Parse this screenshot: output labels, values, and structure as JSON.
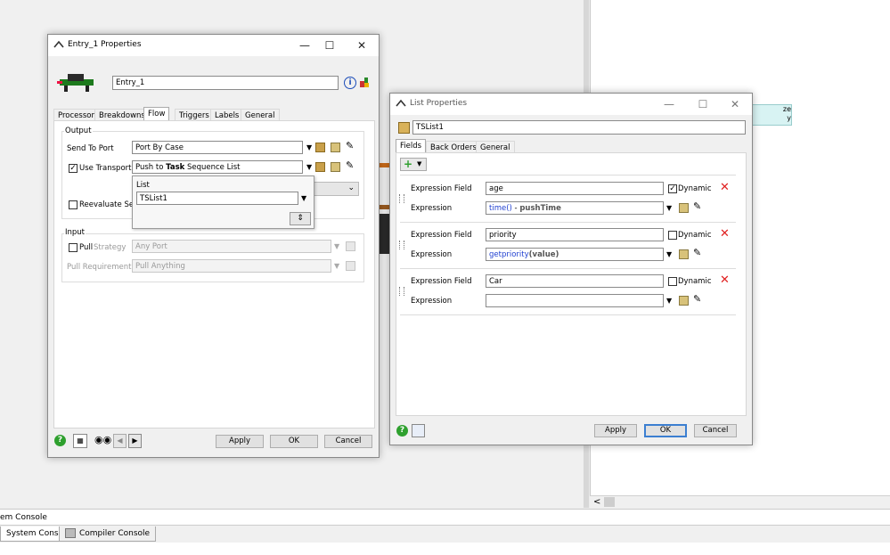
{
  "background": {
    "cyan_node_text": "ze\ny",
    "console_title": "em Console",
    "tabs": [
      {
        "label": "System Console"
      },
      {
        "label": "Compiler Console"
      }
    ]
  },
  "entry_window": {
    "title": "Entry_1  Properties",
    "name_value": "Entry_1",
    "tabs": [
      "Processor",
      "Breakdowns",
      "Flow",
      "Triggers",
      "Labels",
      "General"
    ],
    "selected_tab": "Flow",
    "output": {
      "group_label": "Output",
      "send_to_port_label": "Send To Port",
      "send_to_port_value": "Port By Case",
      "use_transport_label": "Use Transport",
      "use_transport_checked": true,
      "transport_value_pre": "Push to ",
      "transport_value_bold": "Task",
      "transport_value_post": " Sequence List",
      "reevaluate_label": "Reevaluate Sen",
      "popup_list_label": "List",
      "popup_list_value": "TSList1"
    },
    "input": {
      "group_label": "Input",
      "pull_label": "Pull",
      "strategy_label": "Strategy",
      "strategy_value": "Any Port",
      "pull_requirement_label": "Pull Requirement",
      "pull_requirement_value": "Pull Anything"
    },
    "buttons": {
      "apply": "Apply",
      "ok": "OK",
      "cancel": "Cancel"
    }
  },
  "list_window": {
    "title": "List Properties",
    "name_value": "TSList1",
    "tabs": [
      "Fields",
      "Back Orders",
      "General"
    ],
    "selected_tab": "Fields",
    "fields": [
      {
        "field_label": "Expression Field",
        "field_value": "age",
        "dynamic_label": "Dynamic",
        "dynamic_checked": true,
        "expr_label": "Expression",
        "expr_parts": {
          "a": "time()",
          "b": " - ",
          "c": "pushTime"
        }
      },
      {
        "field_label": "Expression Field",
        "field_value": "priority",
        "dynamic_label": "Dynamic",
        "dynamic_checked": false,
        "expr_label": "Expression",
        "expr_parts": {
          "a": "getpriority",
          "b": "(value)",
          "c": ""
        }
      },
      {
        "field_label": "Expression Field",
        "field_value": "Car",
        "dynamic_label": "Dynamic",
        "dynamic_checked": false,
        "expr_label": "Expression",
        "expr_parts": {
          "a": "",
          "b": "",
          "c": ""
        }
      }
    ],
    "buttons": {
      "apply": "Apply",
      "ok": "OK",
      "cancel": "Cancel"
    }
  },
  "colors": {
    "accent": "#3c7fd1",
    "delete": "#e02020",
    "help": "#2ea02e",
    "link_blue": "#1f3fd0"
  }
}
